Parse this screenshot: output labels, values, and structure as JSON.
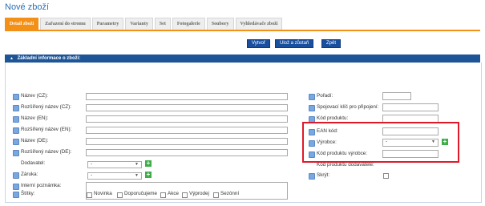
{
  "page": {
    "title": "Nové zboží"
  },
  "tabs": [
    {
      "label": "Detail zboží",
      "active": true
    },
    {
      "label": "Zařazení do stromu"
    },
    {
      "label": "Parametry"
    },
    {
      "label": "Varianty"
    },
    {
      "label": "Set"
    },
    {
      "label": "Fotogalerie"
    },
    {
      "label": "Soubory"
    },
    {
      "label": "Vyhledávače zboží"
    }
  ],
  "actions": {
    "create": "Vytvoř",
    "save_stay": "Ulož a zůstaň",
    "back": "Zpět"
  },
  "section": {
    "title": "Základní informace o zboží:",
    "collapse_glyph": "▲"
  },
  "left_fields": {
    "name_cz": "Název (CZ):",
    "ext_name_cz": "Rozšířený název (CZ):",
    "name_en": "Název (EN):",
    "ext_name_en": "Rozšířený název (EN):",
    "name_de": "Název (DE):",
    "ext_name_de": "Rozšířený název (DE):",
    "supplier": "Dodavatel:",
    "supplier_value": "-",
    "warranty": "Záruka:",
    "warranty_value": "-",
    "internal_note": "Interní poznámka:"
  },
  "right_fields": {
    "order": "Pořadí:",
    "link_key": "Spojovací klíč pro připojení:",
    "product_code": "Kód produktu:",
    "ean": "EAN kód:",
    "manufacturer": "Výrobce:",
    "manufacturer_value": "-",
    "manufacturer_code": "Kód produktu výrobce:",
    "supplier_code": "Kód produktu dodavatele:",
    "hide": "Skrýt:"
  },
  "tags": {
    "label": "Štítky:",
    "items": [
      "Novinka",
      "Doporučujeme",
      "Akce",
      "Výprodej",
      "Sezónní"
    ]
  },
  "colors": {
    "accent": "#f39018",
    "header": "#1e5597",
    "button": "#1a4f9e",
    "highlight": "#e0192a"
  }
}
